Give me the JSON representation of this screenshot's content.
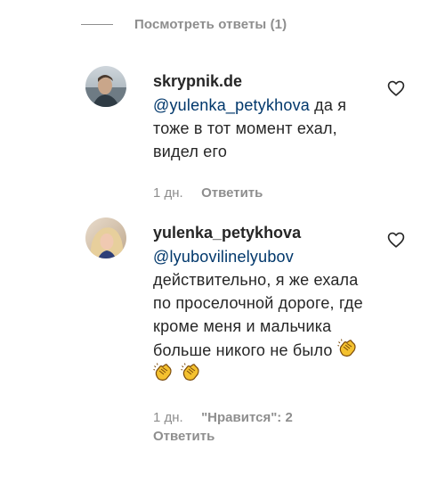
{
  "view_replies": {
    "label": "Посмотреть ответы (1)"
  },
  "comments": [
    {
      "username": "skrypnik.de",
      "mention": "@yulenka_petykhova",
      "text_after_mention": " да я тоже в тот момент ехал, видел его",
      "time": "1 дн.",
      "reply_label": "Ответить",
      "like_icon": "heart-outline-icon"
    },
    {
      "username": "yulenka_petykhova",
      "mention": "@lyubovilinelyubov",
      "text_after_mention": " действительно, я же ехала по проселочной дороге, где кроме меня и мальчика больше никого не было",
      "emojis": [
        "clapping-hands",
        "clapping-hands",
        "clapping-hands"
      ],
      "time": "1 дн.",
      "likes_label": "\"Нравится\": 2",
      "reply_label": "Ответить",
      "like_icon": "heart-outline-icon"
    }
  ],
  "colors": {
    "text": "#262626",
    "muted": "#8e8e8e",
    "mention": "#00376b"
  }
}
